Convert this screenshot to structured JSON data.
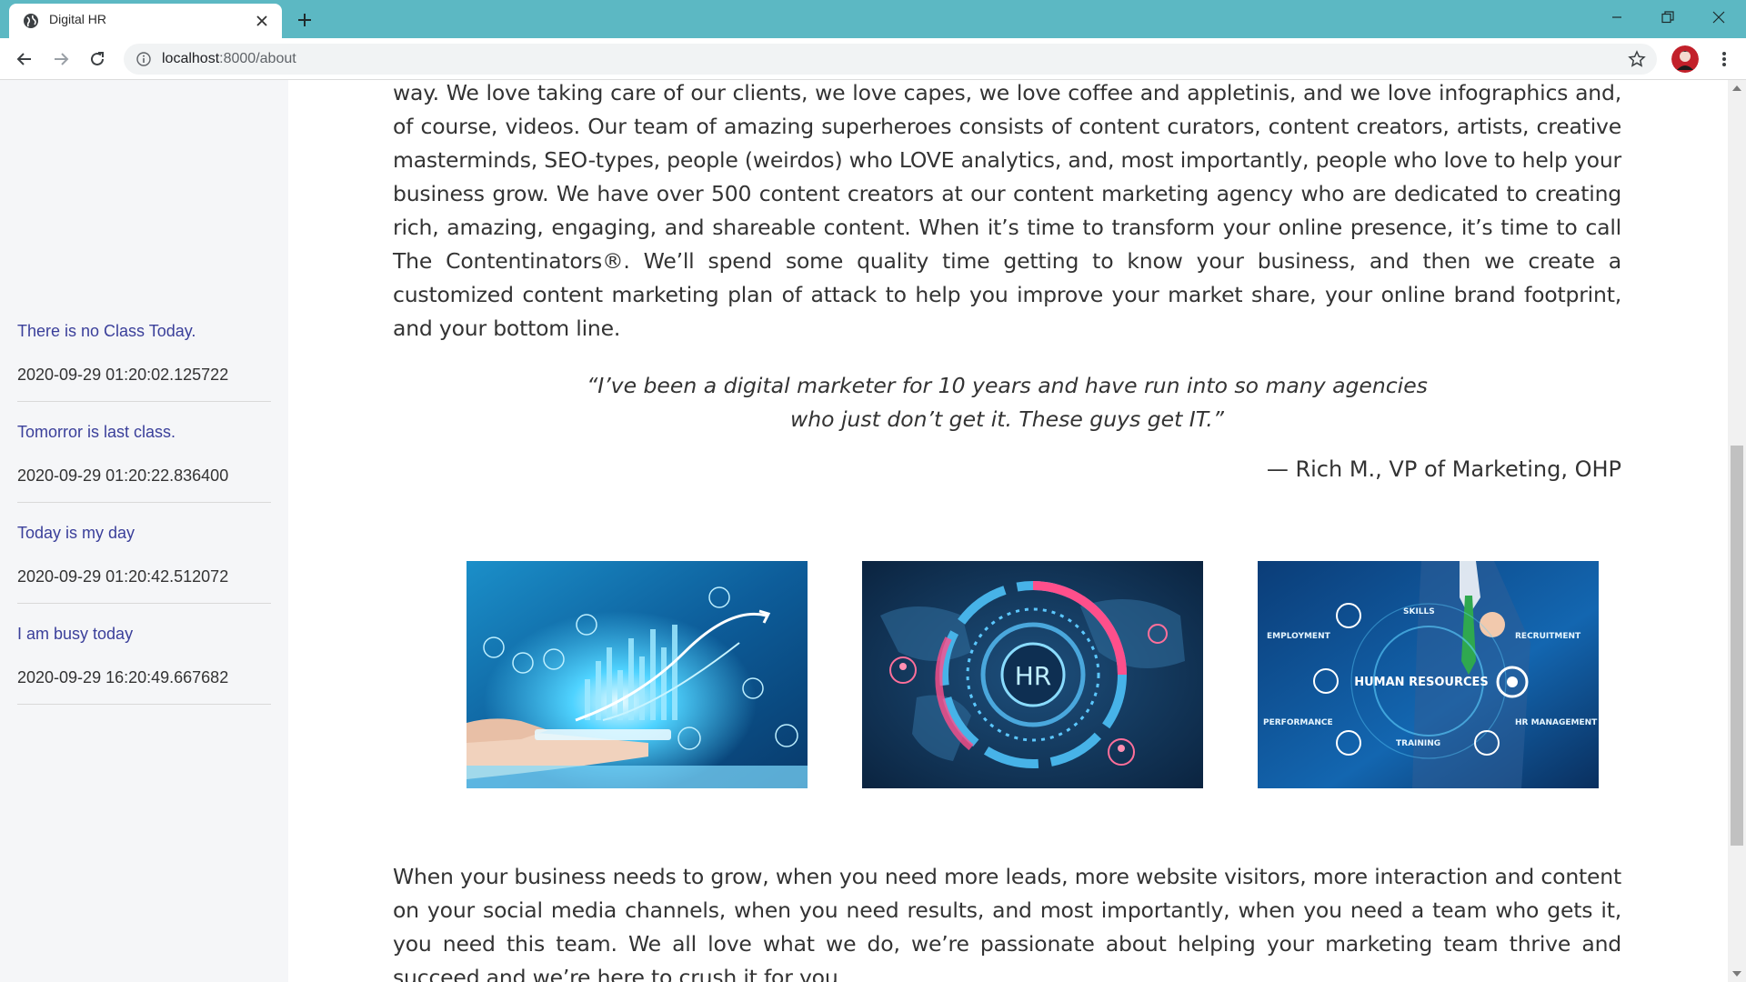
{
  "browser": {
    "tab_title": "Digital HR",
    "url_host": "localhost",
    "url_path": ":8000/about"
  },
  "sidebar": {
    "notices": [
      {
        "title": "There is no Class Today.",
        "date": "2020-09-29 01:20:02.125722"
      },
      {
        "title": "Tomorror is last class.",
        "date": "2020-09-29 01:20:22.836400"
      },
      {
        "title": "Today is my day",
        "date": "2020-09-29 01:20:42.512072"
      },
      {
        "title": "I am busy today",
        "date": "2020-09-29 16:20:49.667682"
      }
    ]
  },
  "content": {
    "paragraph_1": "way. We love taking care of our clients, we love capes, we love coffee and appletinis, and we love infographics and, of course, videos. Our team of amazing superheroes consists of content curators, content creators, artists, creative masterminds, SEO-types, people (weirdos) who LOVE analytics, and, most importantly, people who love to help your business grow. We have over 500 content creators at our content marketing agency who are dedicated to creating rich, amazing, engaging, and shareable content. When it’s time to transform your online presence, it’s time to call The Contentinators®. We’ll spend some quality time getting to know your business, and then we create a customized content marketing plan of attack to help you improve your market share, your online brand footprint, and your bottom line.",
    "quote_line_1": "“I’ve been a digital marketer for 10 years and have run into so many agencies",
    "quote_line_2": "who just don’t get it. These guys get IT.”",
    "attribution": "— Rich M., VP of Marketing, OHP",
    "images": {
      "hr_badge": "HR",
      "tile3_center": "HUMAN RESOURCES",
      "tile3_skills": "SKILLS",
      "tile3_employment": "EMPLOYMENT",
      "tile3_recruitment": "RECRUITMENT",
      "tile3_performance": "PERFORMANCE",
      "tile3_training": "TRAINING",
      "tile3_hrmanagement": "HR MANAGEMENT"
    },
    "paragraph_2": "When your business needs to grow, when you need more leads, more website visitors, more interaction and content on your social media channels, when you need results, and most importantly, when you need a team who gets it, you need this team. We all love what we do, we’re passionate about helping your marketing team thrive and succeed and we’re here to crush it for you."
  },
  "colors": {
    "tabstrip": "#5cb8c3",
    "notice_title": "#3a3f9a",
    "sidebar_bg": "#f5f6f8"
  }
}
